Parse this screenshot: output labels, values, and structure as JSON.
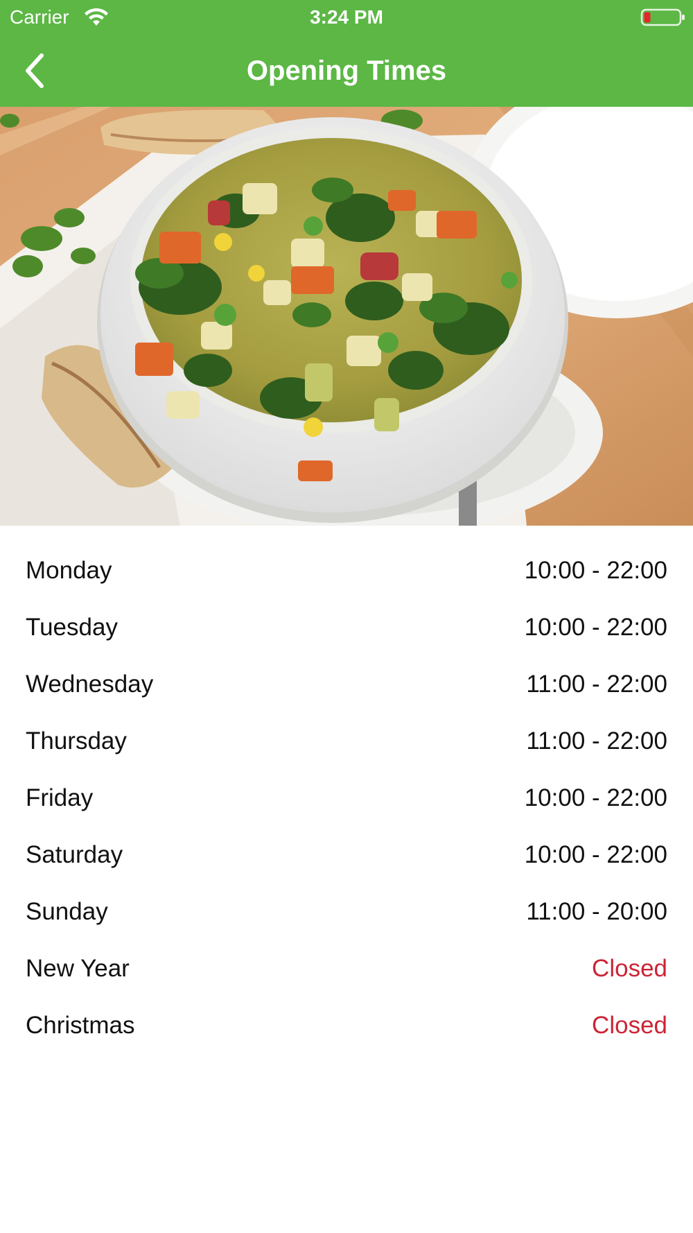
{
  "status_bar": {
    "carrier": "Carrier",
    "time": "3:24 PM"
  },
  "nav": {
    "title": "Opening Times",
    "back_icon": "chevron-left-icon"
  },
  "hero": {
    "icon": "vegetable-soup-photo"
  },
  "opening_times": [
    {
      "day": "Monday",
      "hours": "10:00 - 22:00",
      "closed": false
    },
    {
      "day": "Tuesday",
      "hours": "10:00 - 22:00",
      "closed": false
    },
    {
      "day": "Wednesday",
      "hours": "11:00 - 22:00",
      "closed": false
    },
    {
      "day": "Thursday",
      "hours": "11:00 - 22:00",
      "closed": false
    },
    {
      "day": "Friday",
      "hours": "10:00 - 22:00",
      "closed": false
    },
    {
      "day": "Saturday",
      "hours": "10:00 - 22:00",
      "closed": false
    },
    {
      "day": "Sunday",
      "hours": "11:00 - 20:00",
      "closed": false
    },
    {
      "day": "New Year",
      "hours": "Closed",
      "closed": true
    },
    {
      "day": "Christmas",
      "hours": "Closed",
      "closed": true
    }
  ],
  "colors": {
    "nav_green": "#5cb745",
    "closed_red": "#cc2435",
    "text": "#111111"
  }
}
